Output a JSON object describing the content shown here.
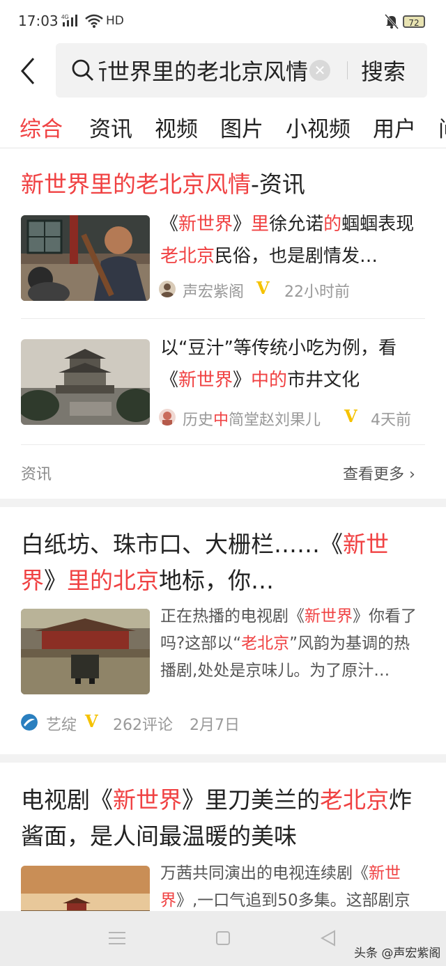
{
  "status_bar": {
    "time": "17:03",
    "network": "4G",
    "hd": "HD",
    "battery": "72"
  },
  "search": {
    "query": "新世界里的老北京风情",
    "clear_icon": "clear-icon",
    "submit_label": "搜索"
  },
  "tabs": [
    "综合",
    "资讯",
    "视频",
    "图片",
    "小视频",
    "用户",
    "问"
  ],
  "news_card": {
    "title_highlight": "新世界里的老北京风情",
    "title_suffix": "-资讯",
    "items": [
      {
        "desc_parts": [
          "《",
          "新世界",
          "》",
          "里",
          "徐允诺",
          "的",
          "蝈蝈表现",
          "老北京",
          "民俗，也是剧情发…"
        ],
        "author_a": "声宏紫阁",
        "author_b": "",
        "author_c": "",
        "time": "22小时前"
      },
      {
        "desc_parts": [
          "以“豆汁”等传统小吃为例，看",
          "《",
          "新世界",
          "》",
          "中的",
          "市井文化"
        ],
        "author_a": "历史",
        "author_b": "中",
        "author_c": "简堂赵刘果儿",
        "time": "4天前"
      }
    ],
    "footer_label": "资讯",
    "more_label": "查看更多"
  },
  "article1": {
    "title_parts": [
      "白纸坊、珠市口、大栅栏……《",
      "新世",
      "界",
      "》",
      "里的北京",
      "地标，你…"
    ],
    "desc_parts": [
      "正在热播的电视剧《",
      "新世界",
      "》你看了吗?这部以“",
      "老北京",
      "”风韵为基调的热播剧,处处是京味儿。为了原汁…"
    ],
    "author": "艺绽",
    "comments": "262评论",
    "date": "2月7日"
  },
  "article2": {
    "title_parts": [
      "电视剧《",
      "新世界",
      "》里刀美兰的",
      "老北京",
      "炸酱面，是人间最温暖的美味"
    ],
    "desc_parts": [
      "万茜共同演出的电视连续剧《",
      "新世界",
      "》,一口气追到50多集。这部剧京"
    ]
  },
  "watermark": "头条 @声宏紫阁",
  "colors": {
    "accent": "#f04142",
    "verified": "#f5c200"
  }
}
